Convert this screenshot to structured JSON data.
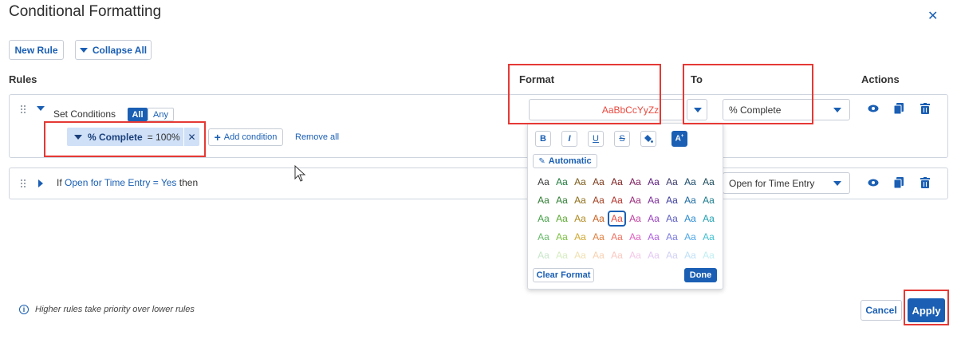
{
  "dialog": {
    "title": "Conditional Formatting",
    "close_icon": "close-icon"
  },
  "toolbar": {
    "new_rule_label": "New Rule",
    "collapse_all_label": "Collapse All"
  },
  "headers": {
    "rules": "Rules",
    "format": "Format",
    "to": "To",
    "actions": "Actions"
  },
  "rule1": {
    "set_conditions_label": "Set Conditions",
    "toggle_all": "All",
    "toggle_any": "Any",
    "condition_field": "% Complete",
    "condition_value": "= 100%",
    "add_condition_label": "Add condition",
    "remove_all_label": "Remove all",
    "format_preview": "AaBbCcYyZz",
    "format_preview_color": "#e8493f",
    "to_value": "% Complete"
  },
  "rule2": {
    "if_label": "If",
    "field": "Open for Time Entry",
    "operator_value": "= Yes",
    "then_label": "then",
    "to_value": "Open for Time Entry"
  },
  "format_popover": {
    "bold_label": "B",
    "italic_label": "I",
    "underline_label": "U",
    "strike_label": "S",
    "automatic_label": "Automatic",
    "swatch_text": "Aa",
    "selected_row": 2,
    "selected_col": 4,
    "swatch_colors": [
      [
        "#3a3a3a",
        "#1e7a3a",
        "#7a5a1a",
        "#7a3a1a",
        "#7a1a1a",
        "#7a1a5a",
        "#5a1a7a",
        "#3a3a6a",
        "#1a4a6a",
        "#1a4a5a"
      ],
      [
        "#2e7d32",
        "#2e7d32",
        "#8d6e1a",
        "#a04020",
        "#b0302a",
        "#9a2a7a",
        "#7a2a9a",
        "#3a3a9a",
        "#1a6aa0",
        "#1a7a8a"
      ],
      [
        "#43a047",
        "#5aa830",
        "#b08a20",
        "#c86020",
        "#e8493f",
        "#c040a0",
        "#9a40c0",
        "#5a5ac0",
        "#2a8ad0",
        "#20a0b0"
      ],
      [
        "#66bb6a",
        "#7cc040",
        "#d0a830",
        "#e08040",
        "#f07060",
        "#e060c0",
        "#b060e0",
        "#7a7ae0",
        "#50a8e8",
        "#40c0d0"
      ],
      [
        "#c8e6c9",
        "#d6ecbf",
        "#f0e0b0",
        "#f8d0b0",
        "#fbc8c0",
        "#f4c8e8",
        "#e4c8f4",
        "#d0d0f4",
        "#c0e0f8",
        "#c0eef2"
      ]
    ],
    "clear_format_label": "Clear Format",
    "done_label": "Done"
  },
  "footer": {
    "info_text": "Higher rules take priority over lower rules",
    "cancel_label": "Cancel",
    "apply_label": "Apply"
  },
  "colors": {
    "accent": "#1a5fb4",
    "highlight_red": "#e53935"
  }
}
